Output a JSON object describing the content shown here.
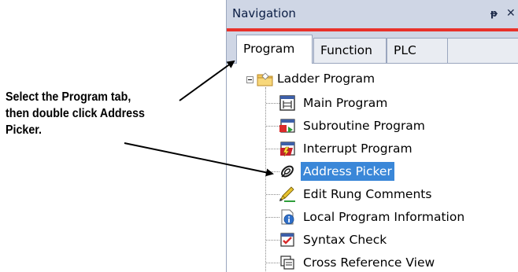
{
  "callout": {
    "lines": [
      "Select the Program tab,",
      "then double click Address",
      "Picker."
    ]
  },
  "panel": {
    "title": "Navigation",
    "pin_glyph": "ᵽ",
    "close_glyph": "✕",
    "accent_color": "#e8312a",
    "tabs": [
      {
        "label": "Program",
        "active": true
      },
      {
        "label": "Function",
        "active": false
      },
      {
        "label": "PLC",
        "active": false
      }
    ],
    "tree": {
      "root": {
        "label": "Ladder Program",
        "icon": "folder-icon",
        "expanded": true
      },
      "items": [
        {
          "label": "Main Program",
          "icon": "main-program-icon",
          "selected": false
        },
        {
          "label": "Subroutine Program",
          "icon": "subroutine-program-icon",
          "selected": false
        },
        {
          "label": "Interrupt Program",
          "icon": "interrupt-program-icon",
          "selected": false
        },
        {
          "label": "Address Picker",
          "icon": "address-picker-icon",
          "selected": true
        },
        {
          "label": "Edit Rung Comments",
          "icon": "edit-rung-comments-icon",
          "selected": false
        },
        {
          "label": "Local Program Information",
          "icon": "program-information-icon",
          "selected": false
        },
        {
          "label": "Syntax Check",
          "icon": "syntax-check-icon",
          "selected": false
        },
        {
          "label": "Cross Reference View",
          "icon": "cross-reference-icon",
          "selected": false
        }
      ]
    },
    "selection_color": "#3a87d8"
  }
}
